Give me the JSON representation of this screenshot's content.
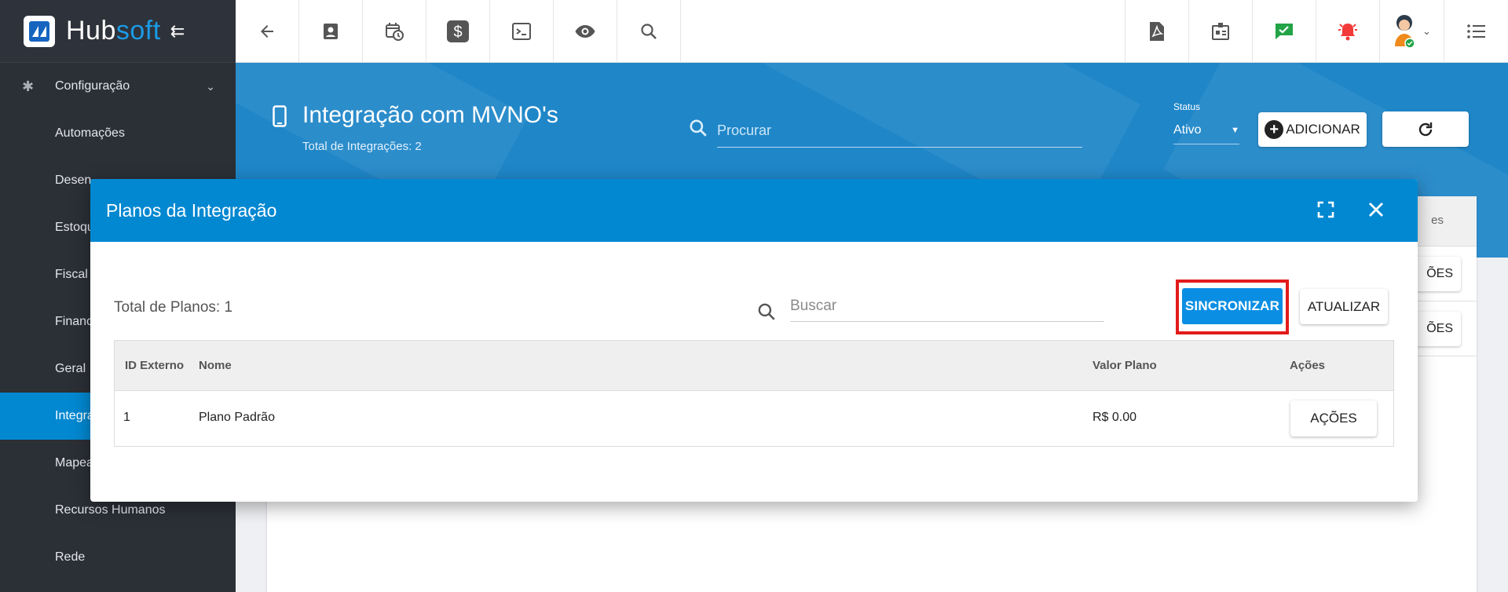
{
  "brand": {
    "name_part1": "Hub",
    "name_part2": "soft"
  },
  "sidebar": {
    "section": "Configuração",
    "items": [
      {
        "label": "Automações"
      },
      {
        "label": "Desen"
      },
      {
        "label": "Estoqu"
      },
      {
        "label": "Fiscal"
      },
      {
        "label": "Financ"
      },
      {
        "label": "Geral"
      },
      {
        "label": "Integra"
      },
      {
        "label": "Mapea"
      },
      {
        "label": "Recursos Humanos"
      },
      {
        "label": "Rede"
      }
    ]
  },
  "page": {
    "title": "Integração com MVNO's",
    "subtitle": "Total de Integrações: 2",
    "search_placeholder": "Procurar",
    "status_label": "Status",
    "status_value": "Ativo",
    "add_label": "ADICIONAR"
  },
  "background_table": {
    "col_label": "es",
    "row_button": "ÕES"
  },
  "modal": {
    "title": "Planos da Integração",
    "total": "Total de Planos: 1",
    "search_placeholder": "Buscar",
    "sync_label": "SINCRONIZAR",
    "refresh_label": "ATUALIZAR",
    "columns": [
      "ID Externo",
      "Nome",
      "Valor Plano",
      "Ações"
    ],
    "rows": [
      {
        "id": "1",
        "name": "Plano Padrão",
        "value": "R$ 0.00",
        "action": "AÇÕES"
      }
    ]
  },
  "colors": {
    "primary": "#0288d1",
    "header": "#1f86c8",
    "sidebar": "#2b2f36",
    "highlight": "#e21b1b"
  }
}
